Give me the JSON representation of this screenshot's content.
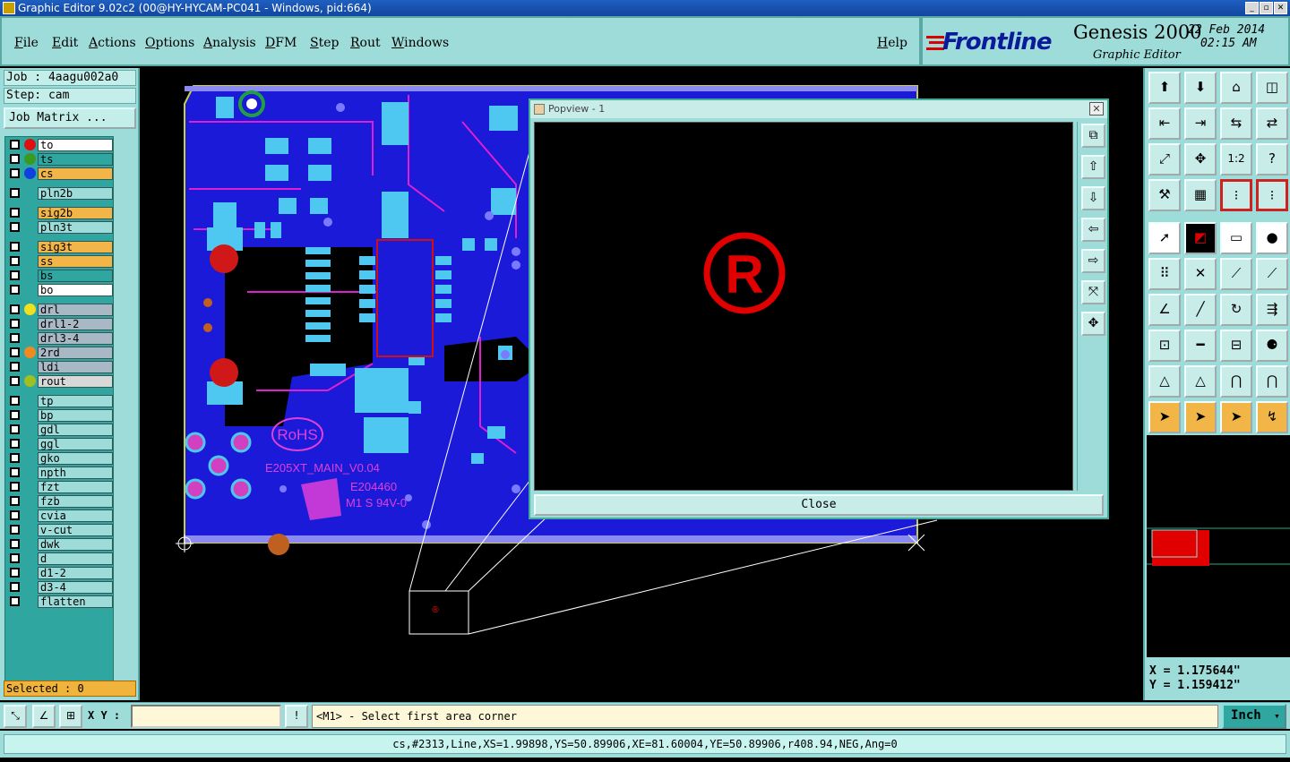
{
  "window": {
    "title": "Graphic Editor 9.02c2 (00@HY-HYCAM-PC041 - Windows, pid:664)"
  },
  "menu": {
    "items": [
      "File",
      "Edit",
      "Actions",
      "Options",
      "Analysis",
      "DFM",
      "Step",
      "Rout",
      "Windows"
    ],
    "help": "Help"
  },
  "brand": {
    "logo": "Frontline",
    "product": "Genesis 2000",
    "subtitle": "Graphic Editor",
    "date": "22 Feb 2014",
    "time": "02:15 AM"
  },
  "job": {
    "job_label": "Job : 4aagu002a0",
    "step_label": "Step: cam",
    "matrix_button": "Job Matrix ..."
  },
  "layers": [
    {
      "name": "to",
      "dot": "#e01010",
      "bg": "#ffffff",
      "edit": true
    },
    {
      "name": "ts",
      "dot": "#3a9a20",
      "bg": "#2fa6a0",
      "edit": false
    },
    {
      "name": "cs",
      "dot": "#1040e0",
      "bg": "#f2b648",
      "edit": true
    },
    {
      "name": "pln2b",
      "dot": "",
      "bg": "#9ddcd8",
      "edit": false
    },
    {
      "name": "sig2b",
      "dot": "",
      "bg": "#f2b648",
      "edit": true
    },
    {
      "name": "pln3t",
      "dot": "",
      "bg": "#9ddcd8",
      "edit": false
    },
    {
      "name": "sig3t",
      "dot": "",
      "bg": "#f2b648",
      "edit": true
    },
    {
      "name": "ss",
      "dot": "",
      "bg": "#f2b648",
      "edit": true
    },
    {
      "name": "bs",
      "dot": "",
      "bg": "#2fa6a0",
      "edit": false
    },
    {
      "name": "bo",
      "dot": "",
      "bg": "#ffffff",
      "edit": true
    },
    {
      "name": "drl",
      "dot": "#f0e020",
      "bg": "#a8b8c4",
      "edit": false
    },
    {
      "name": "drl1-2",
      "dot": "",
      "bg": "#a8b8c4",
      "edit": false
    },
    {
      "name": "drl3-4",
      "dot": "",
      "bg": "#a8b8c4",
      "edit": false
    },
    {
      "name": "2rd",
      "dot": "#f08a20",
      "bg": "#a8b8c4",
      "edit": false
    },
    {
      "name": "ldi",
      "dot": "",
      "bg": "#a8b8c4",
      "edit": false
    },
    {
      "name": "rout",
      "dot": "#a0c020",
      "bg": "#d8d8d8",
      "edit": false
    },
    {
      "name": "tp",
      "dot": "",
      "bg": "#9ddcd8",
      "edit": false
    },
    {
      "name": "bp",
      "dot": "",
      "bg": "#9ddcd8",
      "edit": false
    },
    {
      "name": "gdl",
      "dot": "",
      "bg": "#9ddcd8",
      "edit": true
    },
    {
      "name": "ggl",
      "dot": "",
      "bg": "#9ddcd8",
      "edit": false
    },
    {
      "name": "gko",
      "dot": "",
      "bg": "#9ddcd8",
      "edit": false
    },
    {
      "name": "npth",
      "dot": "",
      "bg": "#9ddcd8",
      "edit": false
    },
    {
      "name": "fzt",
      "dot": "",
      "bg": "#9ddcd8",
      "edit": true
    },
    {
      "name": "fzb",
      "dot": "",
      "bg": "#9ddcd8",
      "edit": true
    },
    {
      "name": "cvia",
      "dot": "",
      "bg": "#9ddcd8",
      "edit": false
    },
    {
      "name": "v-cut",
      "dot": "",
      "bg": "#9ddcd8",
      "edit": false
    },
    {
      "name": "dwk",
      "dot": "",
      "bg": "#9ddcd8",
      "edit": false
    },
    {
      "name": "d",
      "dot": "",
      "bg": "#9ddcd8",
      "edit": false
    },
    {
      "name": "d1-2",
      "dot": "",
      "bg": "#9ddcd8",
      "edit": false
    },
    {
      "name": "d3-4",
      "dot": "",
      "bg": "#9ddcd8",
      "edit": false
    },
    {
      "name": "flatten",
      "dot": "",
      "bg": "#9ddcd8",
      "edit": false
    }
  ],
  "selected": "Selected : 0",
  "board": {
    "silk_rohs": "RoHS",
    "silk_model": "E205XT_MAIN_V0.04",
    "silk_ul": "E204460",
    "silk_rating": "M1 S 94V-0"
  },
  "popview": {
    "title": "Popview - 1",
    "symbol": "®",
    "close_label": "Close"
  },
  "coords": {
    "x": "X = 1.175644\"",
    "y": "Y = 1.159412\""
  },
  "command": {
    "xy_label": "X Y :",
    "xy_value": "",
    "prompt": "<M1> - Select first area corner",
    "units": "Inch"
  },
  "status": "cs,#2313,Line,XS=1.99898,YS=50.89906,XE=81.60004,YE=50.89906,r408.94,NEG,Ang=0",
  "toolbar_icons": [
    "home-top-icon",
    "home-bottom-icon",
    "house-icon",
    "split-view-icon",
    "pan-left-icon",
    "pan-right-icon",
    "flip-icon",
    "mirror-icon",
    "zoom-fit-icon",
    "center-icon",
    "scale-1-2-icon",
    "help-icon",
    "tools-icon",
    "grid-icon",
    "snap-red-icon",
    "snap-red2-icon",
    "pointer-icon",
    "measure-icon",
    "ruler-icon",
    "dot-icon",
    "connect-icon",
    "cross-icon",
    "line-pad-icon",
    "arrow-pad-icon",
    "angle-icon",
    "slash-icon",
    "arc-icon",
    "fuse-icon",
    "pad-select-icon",
    "minus-icon",
    "bracket-icon",
    "cluster-icon",
    "triangle-icon",
    "a-triangle-icon",
    "arch-icon",
    "arch-line-icon",
    "select-arrow-icon",
    "select-box-icon",
    "select-box2-icon",
    "snap-path-icon"
  ]
}
